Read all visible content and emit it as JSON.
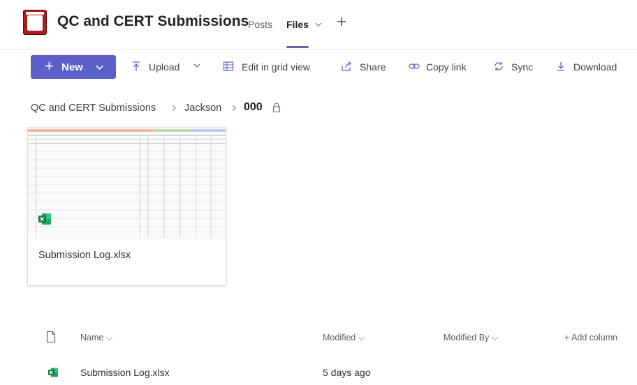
{
  "header": {
    "team_title": "QC and CERT Submissions",
    "tabs": [
      {
        "label": "Posts"
      },
      {
        "label": "Files"
      }
    ],
    "add_tab": "+"
  },
  "toolbar": {
    "new_label": "New",
    "upload_label": "Upload",
    "edit_grid_label": "Edit in grid view",
    "share_label": "Share",
    "copy_link_label": "Copy link",
    "sync_label": "Sync",
    "download_label": "Download"
  },
  "breadcrumb": {
    "items": [
      "QC and CERT Submissions",
      "Jackson"
    ],
    "current": "000"
  },
  "card": {
    "file_name": "Submission Log.xlsx",
    "file_icon": "excel-icon"
  },
  "list": {
    "columns": [
      "Name",
      "Modified",
      "Modified By",
      "Add column"
    ],
    "rows": [
      {
        "name": "Submission Log.xlsx",
        "modified": "5 days ago",
        "modified_by": ""
      }
    ]
  },
  "colors": {
    "accent": "#5b5fc7",
    "tab_underline": "#6264a7",
    "excel_green": "#107c41",
    "logo_red": "#b11b1b"
  }
}
